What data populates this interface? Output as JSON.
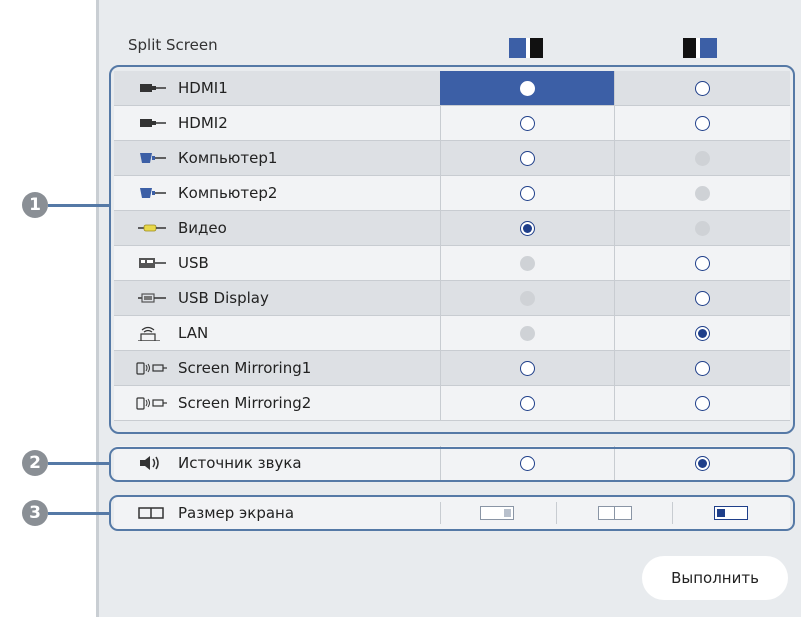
{
  "title": "Split Screen",
  "columns": [
    {
      "icon": "split-left-active-icon"
    },
    {
      "icon": "split-right-active-icon"
    }
  ],
  "callouts": [
    "1",
    "2",
    "3"
  ],
  "sources": [
    {
      "label": "HDMI1",
      "icon": "hdmi-icon",
      "col1": "selected-white",
      "col2": "empty"
    },
    {
      "label": "HDMI2",
      "icon": "hdmi-icon",
      "col1": "empty",
      "col2": "empty"
    },
    {
      "label": "Компьютер1",
      "icon": "computer-port-icon",
      "col1": "empty",
      "col2": "disabled"
    },
    {
      "label": "Компьютер2",
      "icon": "computer-port-icon",
      "col1": "empty",
      "col2": "disabled"
    },
    {
      "label": "Видео",
      "icon": "video-rca-icon",
      "col1": "checked",
      "col2": "disabled"
    },
    {
      "label": "USB",
      "icon": "usb-icon",
      "col1": "disabled",
      "col2": "empty"
    },
    {
      "label": "USB Display",
      "icon": "usb-display-icon",
      "col1": "disabled",
      "col2": "empty"
    },
    {
      "label": "LAN",
      "icon": "lan-icon",
      "col1": "disabled",
      "col2": "checked"
    },
    {
      "label": "Screen Mirroring1",
      "icon": "screen-mirroring-icon",
      "col1": "empty",
      "col2": "empty"
    },
    {
      "label": "Screen Mirroring2",
      "icon": "screen-mirroring-icon",
      "col1": "empty",
      "col2": "empty"
    }
  ],
  "audio": {
    "label": "Источник звука",
    "icon": "speaker-icon",
    "col1": "empty",
    "col2": "checked"
  },
  "screen_size": {
    "label": "Размер экрана",
    "icon": "screen-size-icon",
    "options": [
      "left-large",
      "equal",
      "right-large"
    ],
    "selected": "right-large"
  },
  "execute_label": "Выполнить",
  "colors": {
    "accent": "#3c5fa6",
    "outline": "#5579a6",
    "radio": "#1f3f8a",
    "panel": "#e8ebee"
  }
}
